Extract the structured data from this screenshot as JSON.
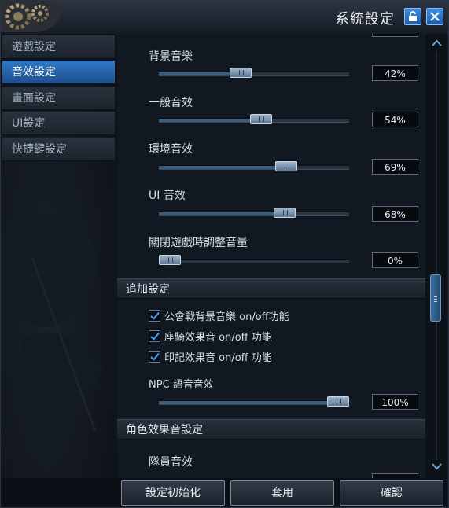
{
  "window": {
    "title": "系統設定"
  },
  "sidebar": {
    "items": [
      {
        "label": "遊戲設定",
        "active": false
      },
      {
        "label": "音效設定",
        "active": true
      },
      {
        "label": "畫面設定",
        "active": false
      },
      {
        "label": "UI設定",
        "active": false
      },
      {
        "label": "快捷鍵設定",
        "active": false
      }
    ]
  },
  "sound": {
    "bgm": {
      "label": "背景音樂",
      "value": "42%",
      "level": 0.42
    },
    "effects": {
      "label": "一般音效",
      "value": "54%",
      "level": 0.54
    },
    "ambient": {
      "label": "環境音效",
      "value": "69%",
      "level": 0.69
    },
    "ui": {
      "label": "UI 音效",
      "value": "68%",
      "level": 0.68
    },
    "close_adjust": {
      "label": "關閉遊戲時調整音量",
      "value": "0%",
      "level": 0.0
    }
  },
  "additional": {
    "header": "追加設定",
    "checks": [
      {
        "label": "公會戰背景音樂 on/off功能",
        "checked": true
      },
      {
        "label": "座騎效果音 on/off 功能",
        "checked": true
      },
      {
        "label": "印記效果音 on/off 功能",
        "checked": true
      }
    ],
    "npc_voice": {
      "label": "NPC 語音音效",
      "value": "100%",
      "level": 1.0
    }
  },
  "character": {
    "header": "角色效果音設定",
    "party_label": "隊員音效"
  },
  "footer": {
    "reset_label": "設定初始化",
    "apply_label": "套用",
    "confirm_label": "確認"
  },
  "colors": {
    "accent": "#2f79c9",
    "check": "#3fa3ff"
  }
}
